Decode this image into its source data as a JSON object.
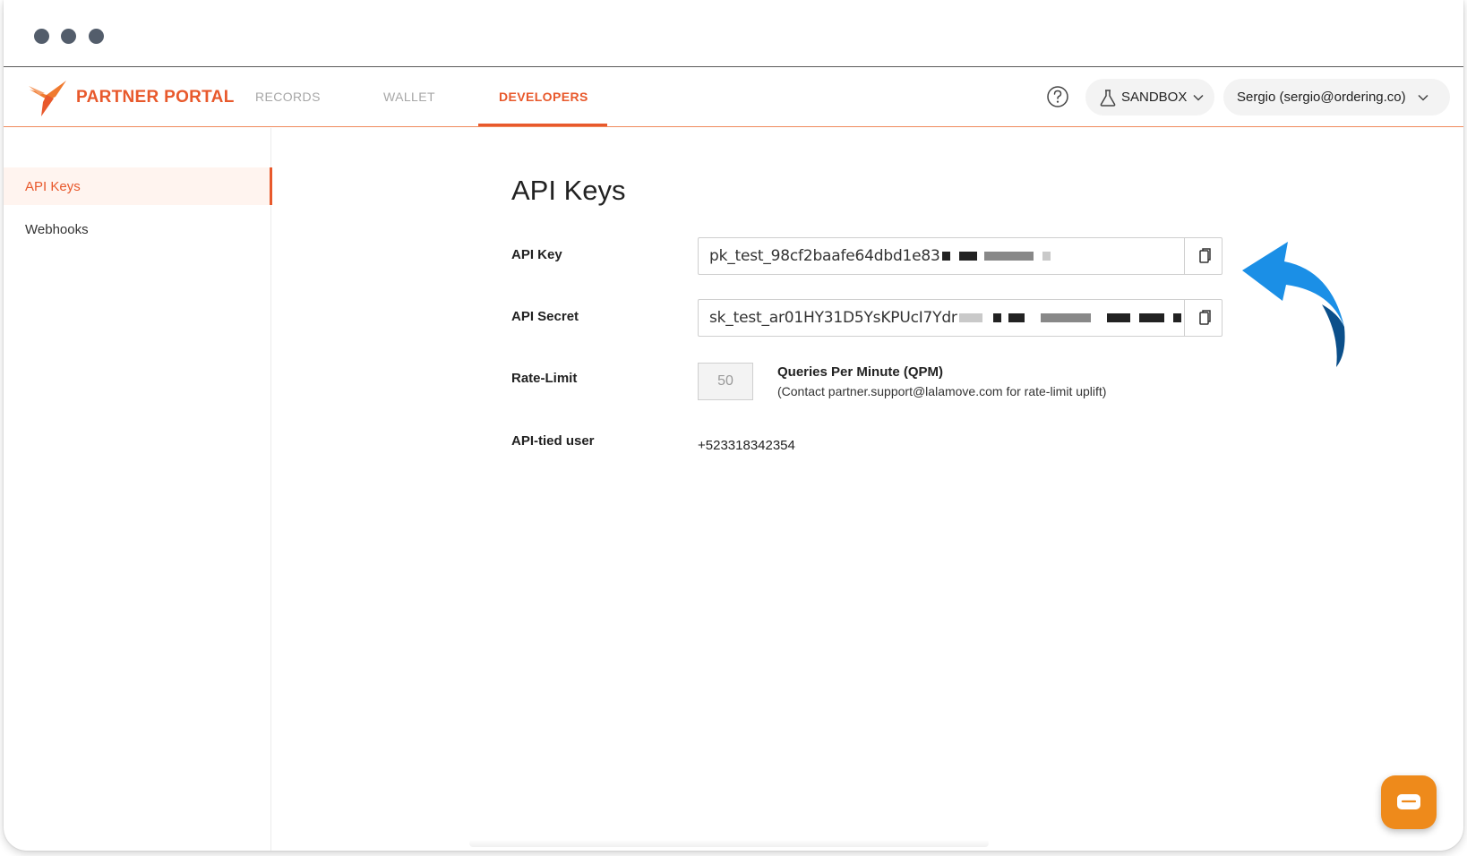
{
  "nav": {
    "brand": "PARTNER PORTAL",
    "tabs": [
      {
        "label": "RECORDS",
        "active": false
      },
      {
        "label": "WALLET",
        "active": false
      },
      {
        "label": "DEVELOPERS",
        "active": true
      }
    ],
    "environment": "SANDBOX",
    "user": "Sergio (sergio@ordering.co)"
  },
  "sidebar": {
    "items": [
      {
        "label": "API Keys",
        "active": true
      },
      {
        "label": "Webhooks",
        "active": false
      }
    ]
  },
  "main": {
    "title": "API Keys",
    "api_key": {
      "label": "API Key",
      "value": "pk_test_98cf2baafe64dbd1e83"
    },
    "api_secret": {
      "label": "API Secret",
      "value": "sk_test_ar01HY31D5YsKPUcI7Ydr"
    },
    "rate_limit": {
      "label": "Rate-Limit",
      "value": "50",
      "unit": "Queries Per Minute (QPM)",
      "note": "(Contact partner.support@lalamove.com for rate-limit uplift)"
    },
    "api_tied_user": {
      "label": "API-tied user",
      "value": "+523318342354"
    }
  },
  "colors": {
    "accent": "#e8592c",
    "arrow": "#1b8fe6",
    "chat": "#ee8a1b"
  },
  "icons": [
    "hummingbird-logo-icon",
    "help-icon",
    "flask-icon",
    "chevron-down-icon",
    "copy-icon",
    "curved-arrow-icon",
    "chat-icon"
  ]
}
